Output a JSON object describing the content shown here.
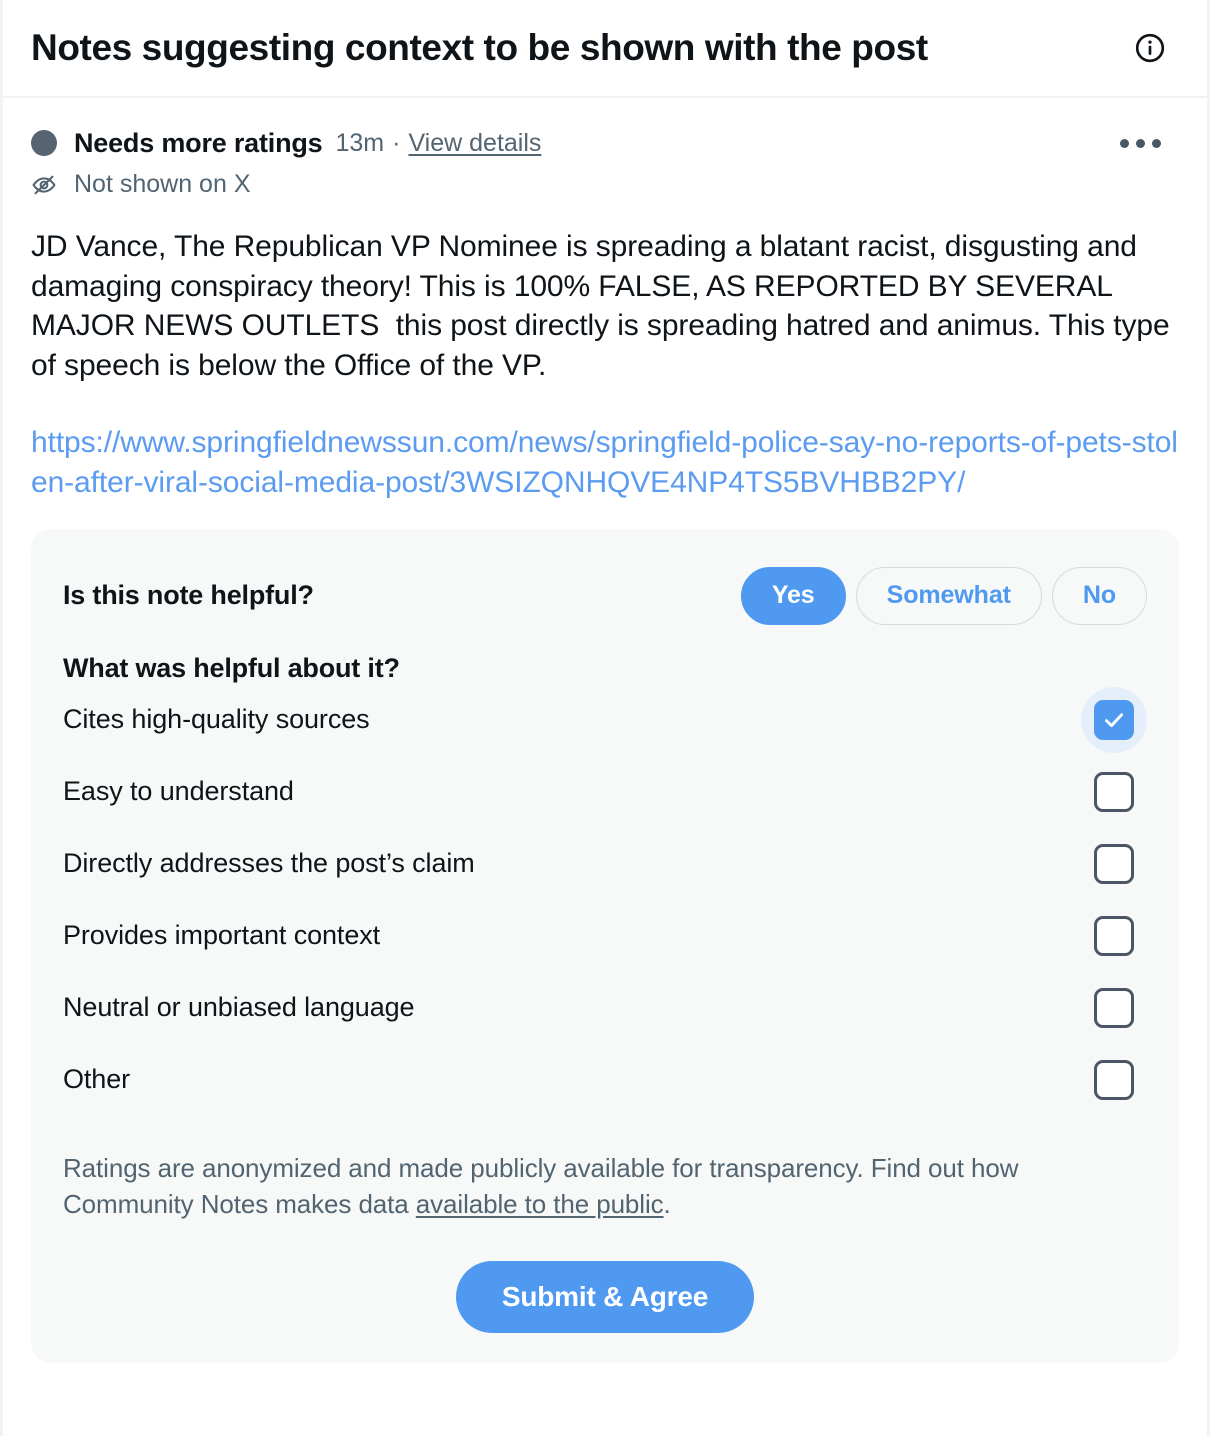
{
  "header": {
    "title": "Notes suggesting context to be shown with the post",
    "info_icon": "info-circle-icon"
  },
  "note": {
    "status_icon": "status-dot-icon",
    "status_label": "Needs more ratings",
    "timestamp": "13m",
    "separator": "·",
    "details_link": "View details",
    "more_icon": "ellipsis-icon",
    "visibility_icon": "eye-slash-icon",
    "visibility_text": "Not shown on X",
    "body": "JD Vance, The Republican VP Nominee is spreading a blatant racist, disgusting and damaging conspiracy theory! This is 100% FALSE, AS REPORTED BY SEVERAL MAJOR NEWS OUTLETS  this post directly is spreading hatred and animus. This type of speech is below the Office of the VP.",
    "source_url": "https://www.springfieldnewssun.com/news/springfield-police-say-no-reports-of-pets-stolen-after-viral-social-media-post/3WSIZQNHQVE4NP4TS5BVHBB2PY/"
  },
  "rating": {
    "helpful_question": "Is this note helpful?",
    "helpful_options": [
      {
        "label": "Yes",
        "selected": true
      },
      {
        "label": "Somewhat",
        "selected": false
      },
      {
        "label": "No",
        "selected": false
      }
    ],
    "reasons_title": "What was helpful about it?",
    "reasons": [
      {
        "label": "Cites high-quality sources",
        "checked": true
      },
      {
        "label": "Easy to understand",
        "checked": false
      },
      {
        "label": "Directly addresses the post’s claim",
        "checked": false
      },
      {
        "label": "Provides important context",
        "checked": false
      },
      {
        "label": "Neutral or unbiased language",
        "checked": false
      },
      {
        "label": "Other",
        "checked": false
      }
    ],
    "disclaimer_part1": "Ratings are anonymized and made publicly available for transparency. Find out how Community Notes makes data ",
    "disclaimer_link": "available to the public",
    "disclaimer_part2": ".",
    "submit_label": "Submit & Agree"
  },
  "colors": {
    "accent_blue": "#4f9af0",
    "link_blue": "#5b9bf0",
    "text_primary": "#0f1419",
    "text_secondary": "#536471",
    "card_background": "#f7f9f9",
    "status_dot": "#566370"
  }
}
